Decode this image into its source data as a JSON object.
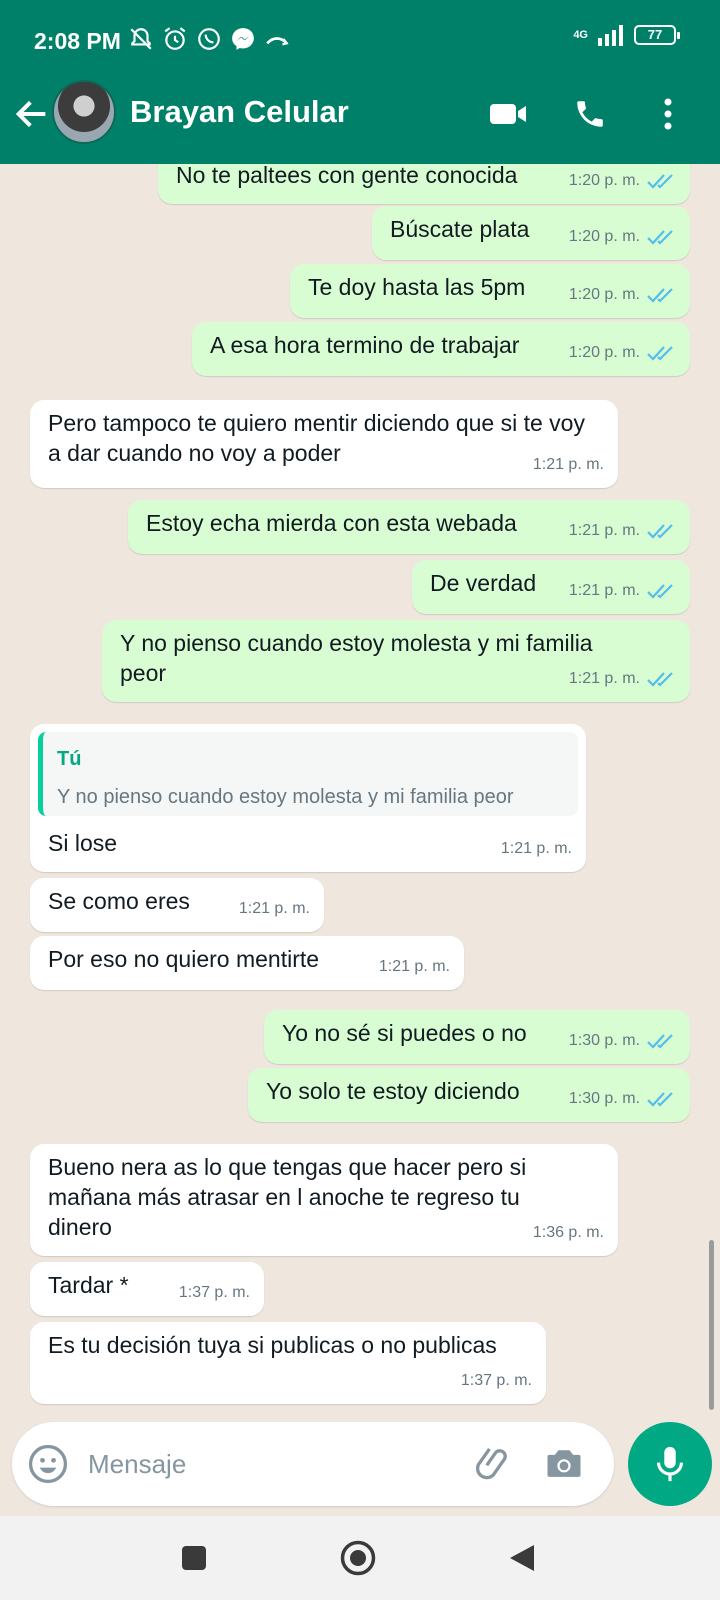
{
  "status_bar": {
    "time": "2:08 PM",
    "network": "4G",
    "battery": "77"
  },
  "header": {
    "contact_name": "Brayan Celular"
  },
  "messages": [
    {
      "dir": "out",
      "text": "No te paltees con gente conocida",
      "time": "1:20 p. m."
    },
    {
      "dir": "out",
      "text": "Búscate plata",
      "time": "1:20 p. m."
    },
    {
      "dir": "out",
      "text": "Te doy hasta las 5pm",
      "time": "1:20 p. m."
    },
    {
      "dir": "out",
      "text": "A esa hora termino de trabajar",
      "time": "1:20 p. m."
    },
    {
      "dir": "in",
      "text": "Pero tampoco te quiero mentir diciendo que si te voy a dar cuando no voy a poder",
      "time": "1:21 p. m."
    },
    {
      "dir": "out",
      "text": "Estoy echa mierda con esta webada",
      "time": "1:21 p. m."
    },
    {
      "dir": "out",
      "text": "De verdad",
      "time": "1:21 p. m."
    },
    {
      "dir": "out",
      "text": "Y no pienso cuando estoy molesta y mi familia peor",
      "time": "1:21 p. m."
    },
    {
      "dir": "in",
      "text": "Si lose",
      "time": "1:21 p. m.",
      "quote": {
        "author": "Tú",
        "text": "Y no pienso cuando estoy molesta y mi familia peor"
      }
    },
    {
      "dir": "in",
      "text": "Se como eres",
      "time": "1:21 p. m."
    },
    {
      "dir": "in",
      "text": "Por eso no quiero mentirte",
      "time": "1:21 p. m."
    },
    {
      "dir": "out",
      "text": "Yo no sé si puedes o no",
      "time": "1:30 p. m."
    },
    {
      "dir": "out",
      "text": "Yo solo te estoy diciendo",
      "time": "1:30 p. m."
    },
    {
      "dir": "in",
      "text": "Bueno nera as lo que tengas que hacer pero si mañana más atrasar en l anoche te regreso tu dinero",
      "time": "1:36 p. m."
    },
    {
      "dir": "in",
      "text": "Tardar *",
      "time": "1:37 p. m."
    },
    {
      "dir": "in",
      "text": "Es tu decisión tuya si publicas o no publicas",
      "time": "1:37 p. m."
    }
  ],
  "composer": {
    "placeholder": "Mensaje"
  },
  "colors": {
    "header": "#008069",
    "outgoing_bubble": "#d9fdd3",
    "incoming_bubble": "#ffffff",
    "read_ticks": "#53bdeb",
    "mic_button": "#00a884"
  }
}
